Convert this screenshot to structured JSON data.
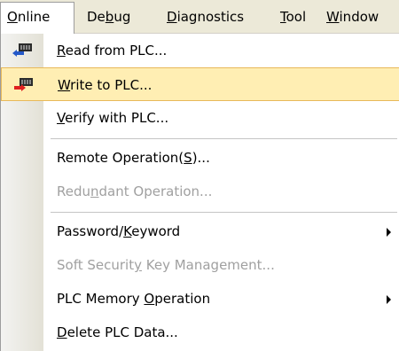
{
  "menubar": {
    "items": [
      {
        "label": "Online",
        "accel": "O"
      },
      {
        "label": "Debug",
        "accel": "b"
      },
      {
        "label": "Diagnostics",
        "accel": "D"
      },
      {
        "label": "Tool",
        "accel": "T"
      },
      {
        "label": "Window",
        "accel": "W"
      }
    ]
  },
  "menu": {
    "items": [
      {
        "label": "Read from PLC...",
        "accel": "R",
        "icon": "read-from-plc-icon",
        "enabled": true
      },
      {
        "label": "Write to PLC...",
        "accel": "W",
        "icon": "write-to-plc-icon",
        "enabled": true,
        "highlighted": true
      },
      {
        "label": "Verify with PLC...",
        "accel": "V",
        "enabled": true
      },
      {
        "label": "Remote Operation(S)...",
        "accel": "S",
        "enabled": true
      },
      {
        "label": "Redundant Operation...",
        "accel": "n",
        "enabled": false
      },
      {
        "label": "Password/Keyword",
        "accel": "K",
        "enabled": true,
        "submenu": true
      },
      {
        "label": "Soft Security Key Management...",
        "accel": "y",
        "enabled": false
      },
      {
        "label": "PLC Memory Operation",
        "accel": "O",
        "enabled": true,
        "submenu": true
      },
      {
        "label": "Delete PLC Data...",
        "accel": "D",
        "enabled": true
      }
    ]
  },
  "colors": {
    "menubar_bg": "#ece9d8",
    "highlight_bg": "#ffeeb3",
    "highlight_border": "#e8b95a",
    "disabled_text": "#a0a0a0"
  }
}
